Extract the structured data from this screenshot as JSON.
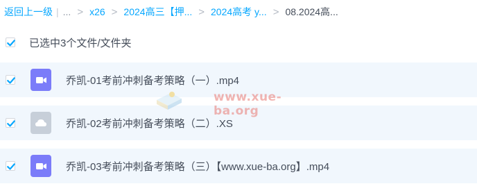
{
  "breadcrumb": {
    "back_label": "返回上一级",
    "separator_bar": "|",
    "ellipsis": "...",
    "chevron": ">",
    "crumbs": [
      "x26",
      "2024高三【押...",
      "2024高考 y...",
      "08.2024高..."
    ]
  },
  "selection": {
    "summary": "已选中3个文件/文件夹"
  },
  "files": [
    {
      "name": "乔凯-01考前冲刺备考策略（一）.mp4",
      "icon": "video-file-icon"
    },
    {
      "name": "乔凯-02考前冲刺备考策略（二）.XS",
      "icon": "cloud-file-icon"
    },
    {
      "name": "乔凯-03考前冲刺备考策略（三）【www.xue-ba.org】.mp4",
      "icon": "video-file-icon"
    }
  ],
  "watermark": {
    "text": "www.xue-ba.org"
  },
  "colors": {
    "accent": "#06a7ff",
    "row_selected_bg": "#f1f7fd",
    "video_icon": "#7b7cf9",
    "generic_icon": "#c7cfd9",
    "watermark": "#e87a74"
  }
}
